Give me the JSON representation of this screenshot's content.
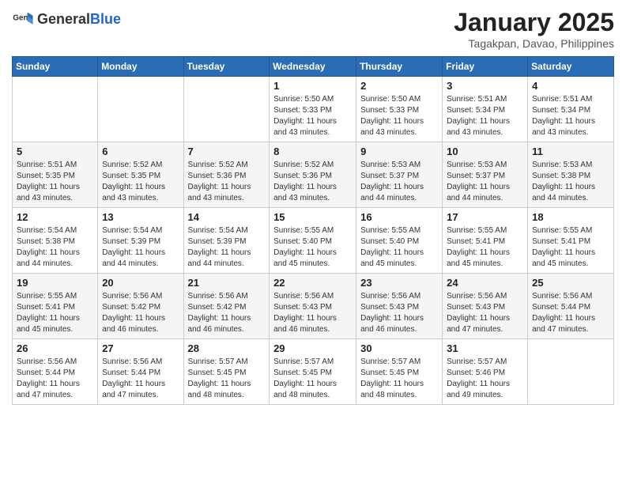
{
  "header": {
    "logo_general": "General",
    "logo_blue": "Blue",
    "title": "January 2025",
    "location": "Tagakpan, Davao, Philippines"
  },
  "weekdays": [
    "Sunday",
    "Monday",
    "Tuesday",
    "Wednesday",
    "Thursday",
    "Friday",
    "Saturday"
  ],
  "weeks": [
    [
      {
        "day": "",
        "info": ""
      },
      {
        "day": "",
        "info": ""
      },
      {
        "day": "",
        "info": ""
      },
      {
        "day": "1",
        "info": "Sunrise: 5:50 AM\nSunset: 5:33 PM\nDaylight: 11 hours and 43 minutes."
      },
      {
        "day": "2",
        "info": "Sunrise: 5:50 AM\nSunset: 5:33 PM\nDaylight: 11 hours and 43 minutes."
      },
      {
        "day": "3",
        "info": "Sunrise: 5:51 AM\nSunset: 5:34 PM\nDaylight: 11 hours and 43 minutes."
      },
      {
        "day": "4",
        "info": "Sunrise: 5:51 AM\nSunset: 5:34 PM\nDaylight: 11 hours and 43 minutes."
      }
    ],
    [
      {
        "day": "5",
        "info": "Sunrise: 5:51 AM\nSunset: 5:35 PM\nDaylight: 11 hours and 43 minutes."
      },
      {
        "day": "6",
        "info": "Sunrise: 5:52 AM\nSunset: 5:35 PM\nDaylight: 11 hours and 43 minutes."
      },
      {
        "day": "7",
        "info": "Sunrise: 5:52 AM\nSunset: 5:36 PM\nDaylight: 11 hours and 43 minutes."
      },
      {
        "day": "8",
        "info": "Sunrise: 5:52 AM\nSunset: 5:36 PM\nDaylight: 11 hours and 43 minutes."
      },
      {
        "day": "9",
        "info": "Sunrise: 5:53 AM\nSunset: 5:37 PM\nDaylight: 11 hours and 44 minutes."
      },
      {
        "day": "10",
        "info": "Sunrise: 5:53 AM\nSunset: 5:37 PM\nDaylight: 11 hours and 44 minutes."
      },
      {
        "day": "11",
        "info": "Sunrise: 5:53 AM\nSunset: 5:38 PM\nDaylight: 11 hours and 44 minutes."
      }
    ],
    [
      {
        "day": "12",
        "info": "Sunrise: 5:54 AM\nSunset: 5:38 PM\nDaylight: 11 hours and 44 minutes."
      },
      {
        "day": "13",
        "info": "Sunrise: 5:54 AM\nSunset: 5:39 PM\nDaylight: 11 hours and 44 minutes."
      },
      {
        "day": "14",
        "info": "Sunrise: 5:54 AM\nSunset: 5:39 PM\nDaylight: 11 hours and 44 minutes."
      },
      {
        "day": "15",
        "info": "Sunrise: 5:55 AM\nSunset: 5:40 PM\nDaylight: 11 hours and 45 minutes."
      },
      {
        "day": "16",
        "info": "Sunrise: 5:55 AM\nSunset: 5:40 PM\nDaylight: 11 hours and 45 minutes."
      },
      {
        "day": "17",
        "info": "Sunrise: 5:55 AM\nSunset: 5:41 PM\nDaylight: 11 hours and 45 minutes."
      },
      {
        "day": "18",
        "info": "Sunrise: 5:55 AM\nSunset: 5:41 PM\nDaylight: 11 hours and 45 minutes."
      }
    ],
    [
      {
        "day": "19",
        "info": "Sunrise: 5:55 AM\nSunset: 5:41 PM\nDaylight: 11 hours and 45 minutes."
      },
      {
        "day": "20",
        "info": "Sunrise: 5:56 AM\nSunset: 5:42 PM\nDaylight: 11 hours and 46 minutes."
      },
      {
        "day": "21",
        "info": "Sunrise: 5:56 AM\nSunset: 5:42 PM\nDaylight: 11 hours and 46 minutes."
      },
      {
        "day": "22",
        "info": "Sunrise: 5:56 AM\nSunset: 5:43 PM\nDaylight: 11 hours and 46 minutes."
      },
      {
        "day": "23",
        "info": "Sunrise: 5:56 AM\nSunset: 5:43 PM\nDaylight: 11 hours and 46 minutes."
      },
      {
        "day": "24",
        "info": "Sunrise: 5:56 AM\nSunset: 5:43 PM\nDaylight: 11 hours and 47 minutes."
      },
      {
        "day": "25",
        "info": "Sunrise: 5:56 AM\nSunset: 5:44 PM\nDaylight: 11 hours and 47 minutes."
      }
    ],
    [
      {
        "day": "26",
        "info": "Sunrise: 5:56 AM\nSunset: 5:44 PM\nDaylight: 11 hours and 47 minutes."
      },
      {
        "day": "27",
        "info": "Sunrise: 5:56 AM\nSunset: 5:44 PM\nDaylight: 11 hours and 47 minutes."
      },
      {
        "day": "28",
        "info": "Sunrise: 5:57 AM\nSunset: 5:45 PM\nDaylight: 11 hours and 48 minutes."
      },
      {
        "day": "29",
        "info": "Sunrise: 5:57 AM\nSunset: 5:45 PM\nDaylight: 11 hours and 48 minutes."
      },
      {
        "day": "30",
        "info": "Sunrise: 5:57 AM\nSunset: 5:45 PM\nDaylight: 11 hours and 48 minutes."
      },
      {
        "day": "31",
        "info": "Sunrise: 5:57 AM\nSunset: 5:46 PM\nDaylight: 11 hours and 49 minutes."
      },
      {
        "day": "",
        "info": ""
      }
    ]
  ]
}
